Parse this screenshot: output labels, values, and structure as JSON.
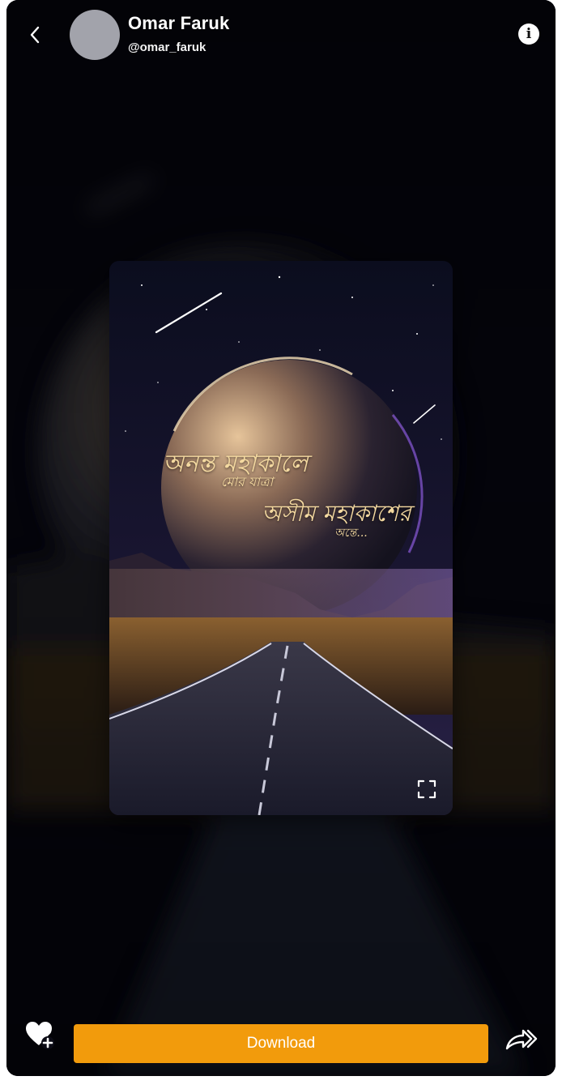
{
  "header": {
    "user_name": "Omar Faruk",
    "user_handle": "@omar_faruk",
    "info_icon_glyph": "i"
  },
  "wallpaper": {
    "caption_line1": "অনন্ত মহাকালে",
    "caption_line2": "মোর যাত্রা",
    "caption_line3": "অসীম মহাকাশের",
    "caption_line4": "অন্তে..."
  },
  "footer": {
    "download_label": "Download"
  },
  "icons": {
    "back": "chevron-left-icon",
    "info": "info-icon",
    "fullscreen": "fullscreen-icon",
    "favorite": "heart-plus-icon",
    "share": "share-forward-icon"
  },
  "colors": {
    "accent": "#f29b0c",
    "avatar_placeholder": "#a2a3ab",
    "background": "#05050c"
  }
}
